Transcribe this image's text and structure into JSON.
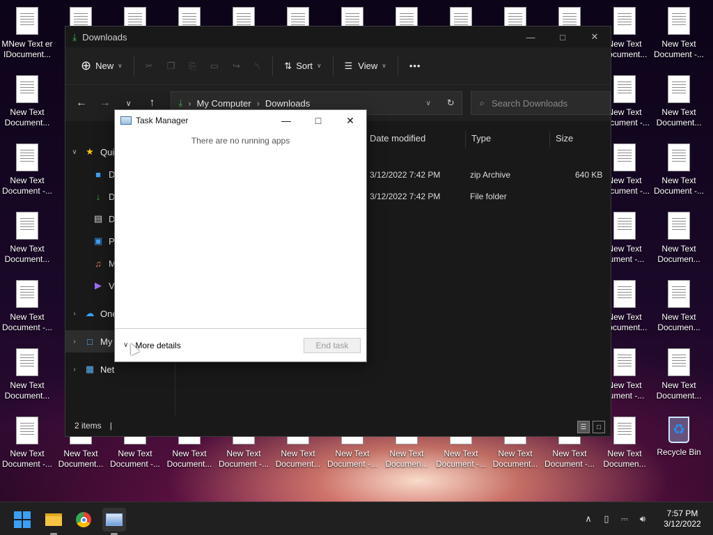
{
  "desktop": {
    "icons_col_left": [
      {
        "label": "MNew Text er\nIDocument..."
      },
      {
        "label": "New Text\nDocument..."
      },
      {
        "label": "New Text\nDocument -..."
      },
      {
        "label": "New Text\nDocument..."
      },
      {
        "label": "New Text\nDocument -..."
      },
      {
        "label": "New Text\nDocument..."
      },
      {
        "label": "New Text\nDocument -..."
      }
    ],
    "icons_col_r1": [
      {
        "label": "New Text\nDocument..."
      },
      {
        "label": "New Text\nDocument -..."
      },
      {
        "label": "New Text\nDocument -..."
      },
      {
        "label": "New Text\ncument -..."
      },
      {
        "label": "New Text\nDocument..."
      },
      {
        "label": "New Text\ncument -..."
      },
      {
        "label": "New Text\nDocumen..."
      }
    ],
    "icons_col_r2": [
      {
        "label": "New Text\nDocument -..."
      },
      {
        "label": "New Text\nDocument..."
      },
      {
        "label": "New Text\nDocument -..."
      },
      {
        "label": "New Text\nDocumen..."
      },
      {
        "label": "New Text\nDocumen..."
      },
      {
        "label": "New Text\nDocument..."
      }
    ],
    "bottom_row": [
      {
        "label": "New Text\nDocument..."
      },
      {
        "label": "New Text\nDocument -..."
      },
      {
        "label": "New Text\nDocument..."
      },
      {
        "label": "New Text\nDocument -..."
      },
      {
        "label": "New Text\nDocument..."
      },
      {
        "label": "New Text\nDocument -..."
      },
      {
        "label": "New Text\nDocumen..."
      },
      {
        "label": "New Text\nDocument -..."
      },
      {
        "label": "New Text\nDocument..."
      },
      {
        "label": "New Text\nDocument -..."
      }
    ],
    "recycle_bin": "Recycle Bin"
  },
  "explorer": {
    "title": "Downloads",
    "toolbar": {
      "new_label": "New",
      "sort_label": "Sort",
      "view_label": "View",
      "more": "•••"
    },
    "address": {
      "root": "My Computer",
      "current": "Downloads"
    },
    "search_placeholder": "Search Downloads",
    "sidebar": [
      {
        "label": "Quick access",
        "short": "Qui",
        "icon": "★",
        "icon_color": "#f5c518",
        "expanded": true
      },
      {
        "label": "Desktop",
        "short": "De",
        "icon": "■",
        "icon_color": "#3aa0f5"
      },
      {
        "label": "Downloads",
        "short": "Do",
        "icon": "↓",
        "icon_color": "#3fb950"
      },
      {
        "label": "Documents",
        "short": "Do",
        "icon": "▤",
        "icon_color": "#cfcfcf"
      },
      {
        "label": "Pictures",
        "short": "Pi",
        "icon": "▣",
        "icon_color": "#3aa0f5"
      },
      {
        "label": "Music",
        "short": "M",
        "icon": "♫",
        "icon_color": "#e07b6a"
      },
      {
        "label": "Videos",
        "short": "Vi",
        "icon": "▶",
        "icon_color": "#a06cf0"
      },
      {
        "label": "OneDrive",
        "short": "One",
        "icon": "☁",
        "icon_color": "#3aa0f5"
      },
      {
        "label": "My Computer",
        "short": "My",
        "icon": "□",
        "icon_color": "#5fb4f5"
      },
      {
        "label": "Network",
        "short": "Net",
        "icon": "▦",
        "icon_color": "#5fb4f5"
      }
    ],
    "columns": {
      "date": "Date modified",
      "type": "Type",
      "size": "Size"
    },
    "rows": [
      {
        "date": "3/12/2022 7:42 PM",
        "type": "zip Archive",
        "size": "640 KB"
      },
      {
        "date": "3/12/2022 7:42 PM",
        "type": "File folder",
        "size": ""
      }
    ],
    "status": "2 items"
  },
  "taskmgr": {
    "title": "Task Manager",
    "empty_msg": "There are no running apps",
    "more_details": "More details",
    "end_task": "End task"
  },
  "taskbar": {
    "time": "7:57 PM",
    "date": "3/12/2022"
  }
}
